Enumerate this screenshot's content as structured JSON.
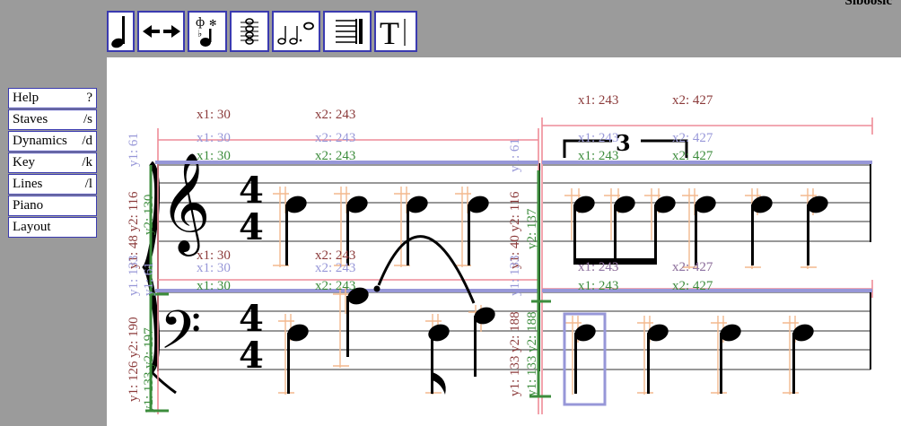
{
  "app": {
    "title": "Siboosic"
  },
  "toolbar": {
    "buttons": [
      {
        "name": "note-duration",
        "icon": "quarter-note-icon"
      },
      {
        "name": "note-shift",
        "icon": "left-right-arrows-icon"
      },
      {
        "name": "accidentals",
        "icon": "accidental-note-icon"
      },
      {
        "name": "chord-stack",
        "icon": "stacked-notes-icon"
      },
      {
        "name": "note-values",
        "icon": "note-values-icon"
      },
      {
        "name": "staff-lines",
        "icon": "staff-lines-icon"
      },
      {
        "name": "text-tool",
        "icon": "text-cursor-icon"
      }
    ]
  },
  "menu": {
    "items": [
      {
        "label": "Help",
        "shortcut": "?"
      },
      {
        "label": "Staves",
        "shortcut": "/s"
      },
      {
        "label": "Dynamics",
        "shortcut": "/d"
      },
      {
        "label": "Key",
        "shortcut": "/k"
      },
      {
        "label": "Lines",
        "shortcut": "/l"
      },
      {
        "label": "Piano",
        "shortcut": ""
      },
      {
        "label": "Layout",
        "shortcut": ""
      }
    ]
  },
  "score": {
    "time_signature": {
      "top": "4",
      "bottom": "4"
    },
    "tuplet": "3",
    "colors": {
      "red": "#8b3a3a",
      "pink": "#ee8c98",
      "blue": "#9797d8",
      "green": "#3c8c3c",
      "orange": "#f3b98e",
      "black": "#000000"
    },
    "m1": {
      "top": {
        "red": [
          "x1: 30",
          "x2: 243"
        ],
        "blue": [
          "x1: 30",
          "x2: 243"
        ],
        "green": [
          "x1: 30",
          "x2: 243"
        ]
      },
      "bottom": {
        "red": [
          "x1: 30",
          "x2: 243"
        ],
        "blue": [
          "x1: 30",
          "x2: 243"
        ],
        "green": [
          "x1: 30",
          "x2: 243"
        ]
      },
      "left_labels": {
        "red": "y1: 126  y2: 190",
        "pink": "y1: 48  y2: 116",
        "blue": "y1: 61",
        "blue2": "y1: 133",
        "green": "y1: 133  y2: 197"
      },
      "mid_labels": {
        "green": "y2: 130",
        "blue": "y1: 61"
      }
    },
    "m2": {
      "top": {
        "red": [
          "x1: 243",
          "x2: 427"
        ],
        "blue": [
          "x1: 243",
          "x2: 427"
        ],
        "green": [
          "x1: 243",
          "x2: 427"
        ]
      },
      "bottom": {
        "red": [
          "x1: 243",
          "x2: 427"
        ],
        "blue": [
          "x1: 243",
          "x2: 427"
        ],
        "green": [
          "x1: 243",
          "x2: 427"
        ]
      },
      "left_labels": {
        "red": "y1: 133  y2: 188",
        "pink": "y1: 40  y2: 116",
        "blue": "y1: 61",
        "blue2": "y1: 133",
        "green": "y2: 137",
        "green2": "y1: 133  y2: 188"
      }
    }
  }
}
